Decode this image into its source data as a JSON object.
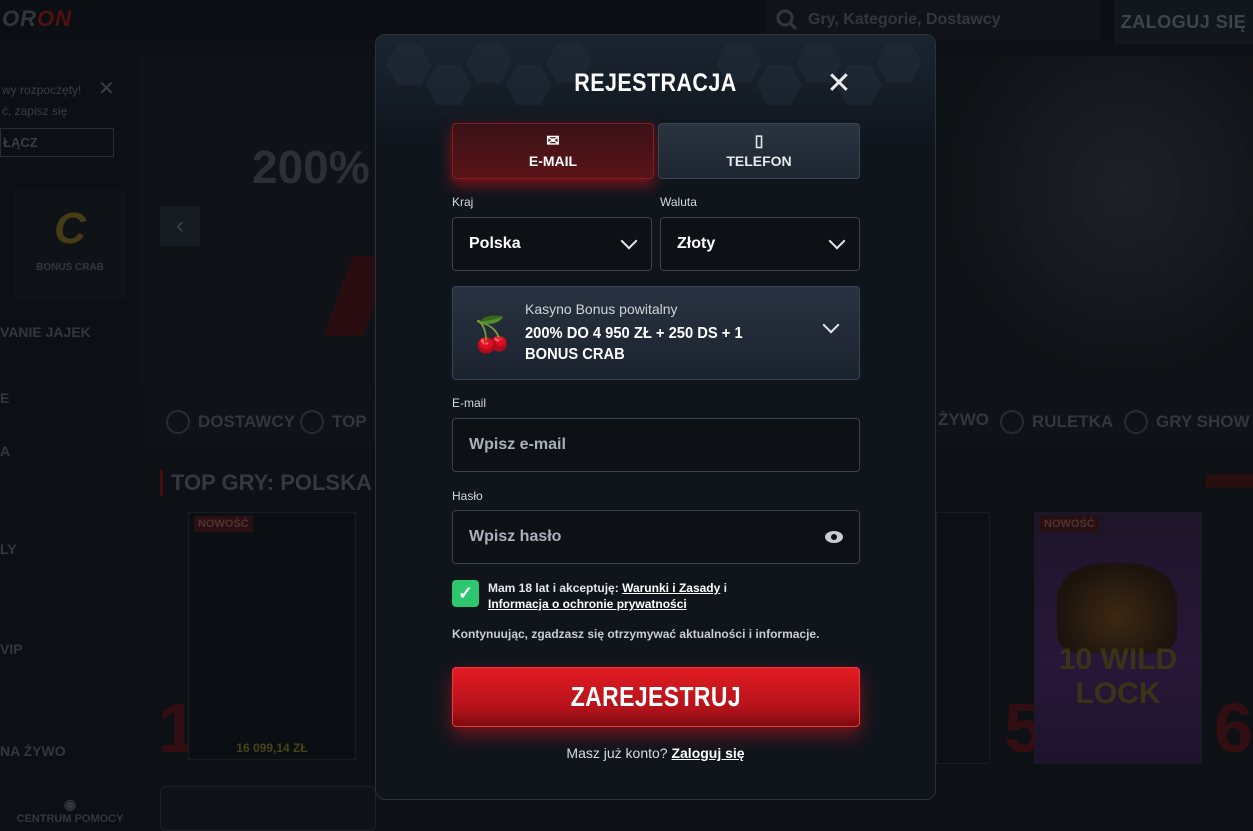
{
  "background": {
    "logo": "ORION",
    "logo_prefix": "OR",
    "logo_suffix": "ON",
    "search_placeholder": "Gry, Kategorie, Dostawcy",
    "login_button": "ZALOGUJ SIĘ",
    "toast_line1": "wy rozpoczęty!",
    "toast_line2": "ć, zapisz się",
    "toast_button": "ŁĄCZ",
    "bonus_crab_label": "BONUS CRAB",
    "egg_label": "VANIE JAJEK",
    "hero_text": "200%",
    "categories": {
      "dostawcy": "DOSTAWCY",
      "top": "TOP",
      "zywo": "ŻYWO",
      "ruletka": "RULETKA",
      "gry_show": "GRY SHOW"
    },
    "sidebar_labels": [
      "E",
      "A",
      "LY",
      "VIP",
      "NA ŻYWO"
    ],
    "help_label": "CENTRUM POMOCY",
    "top_games_title": "TOP GRY: POLSKA",
    "badge_new": "NOWOŚĆ",
    "card1_amount": "16 099,14 ZŁ",
    "rank_1": "1",
    "rank_5": "5",
    "rank_6": "6",
    "wild_lock_line1": "10 WILD",
    "wild_lock_line2": "LOCK"
  },
  "modal": {
    "title": "REJESTRACJA",
    "close_icon": "close-icon",
    "tabs": [
      {
        "label": "E-MAIL",
        "icon": "envelope-icon",
        "active": true
      },
      {
        "label": "TELEFON",
        "icon": "phone-icon",
        "active": false
      }
    ],
    "country": {
      "label": "Kraj",
      "value": "Polska"
    },
    "currency": {
      "label": "Waluta",
      "value": "Złoty"
    },
    "bonus": {
      "subtitle": "Kasyno Bonus powitalny",
      "title": "200% DO 4 950 ZŁ + 250 DS + 1 BONUS CRAB",
      "icon": "cherry-icon"
    },
    "email": {
      "label": "E-mail",
      "placeholder": "Wpisz e-mail"
    },
    "password": {
      "label": "Hasło",
      "placeholder": "Wpisz hasło"
    },
    "terms": {
      "checked": true,
      "prefix": "Mam 18 lat i akceptuję:",
      "link1": "Warunki i Zasady",
      "conj": "i",
      "link2": "Informacja o ochronie prywatności"
    },
    "consent_text": "Kontynuując, zgadzasz się otrzymywać aktualności i informacje.",
    "submit_label": "ZAREJESTRUJ",
    "have_account": "Masz już konto?",
    "login_link": "Zaloguj się"
  },
  "colors": {
    "accent_red": "#e21b22",
    "check_green": "#2cc76e",
    "modal_bg": "#10151c"
  }
}
